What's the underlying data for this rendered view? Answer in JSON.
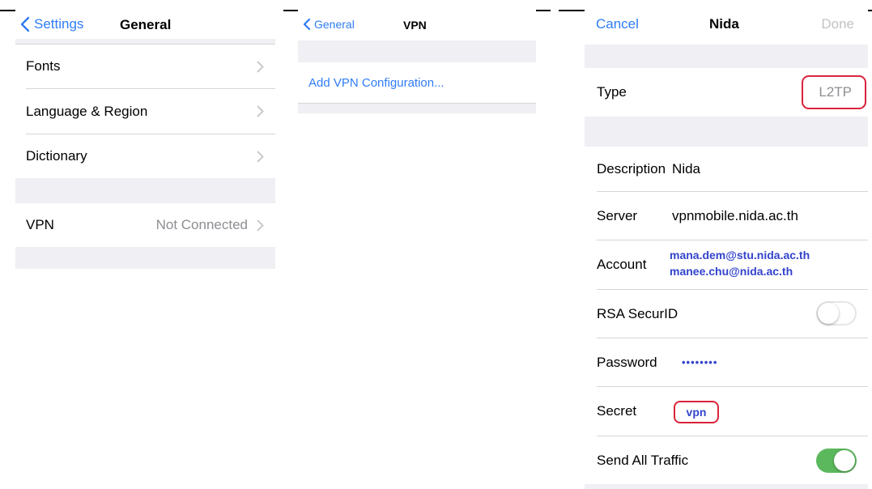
{
  "panel1": {
    "back_label": "Settings",
    "title": "General",
    "items": [
      {
        "label": "Fonts"
      },
      {
        "label": "Language & Region"
      },
      {
        "label": "Dictionary"
      }
    ],
    "vpn": {
      "label": "VPN",
      "value": "Not Connected"
    }
  },
  "panel2": {
    "back_label": "General",
    "title": "VPN",
    "add_config": "Add VPN Configuration..."
  },
  "panel3": {
    "cancel": "Cancel",
    "title": "Nida",
    "done": "Done",
    "type": {
      "label": "Type",
      "value": "L2TP"
    },
    "description": {
      "label": "Description",
      "value": "Nida"
    },
    "server": {
      "label": "Server",
      "value": "vpnmobile.nida.ac.th"
    },
    "account": {
      "label": "Account",
      "value1": "mana.dem@stu.nida.ac.th",
      "value2": "manee.chu@nida.ac.th"
    },
    "rsa": {
      "label": "RSA SecurID",
      "on": false
    },
    "password": {
      "label": "Password",
      "value": "••••••••"
    },
    "secret": {
      "label": "Secret",
      "value": "vpn"
    },
    "send_all": {
      "label": "Send All Traffic",
      "on": true
    }
  },
  "colors": {
    "ios_blue": "#2f7cf6",
    "annotation_blue": "#3344cc",
    "annotation_red": "#d9233a",
    "toggle_green": "#5cb85c",
    "group_bg": "#efeff4"
  },
  "icons": [
    "chevron-left-icon",
    "chevron-right-icon"
  ]
}
